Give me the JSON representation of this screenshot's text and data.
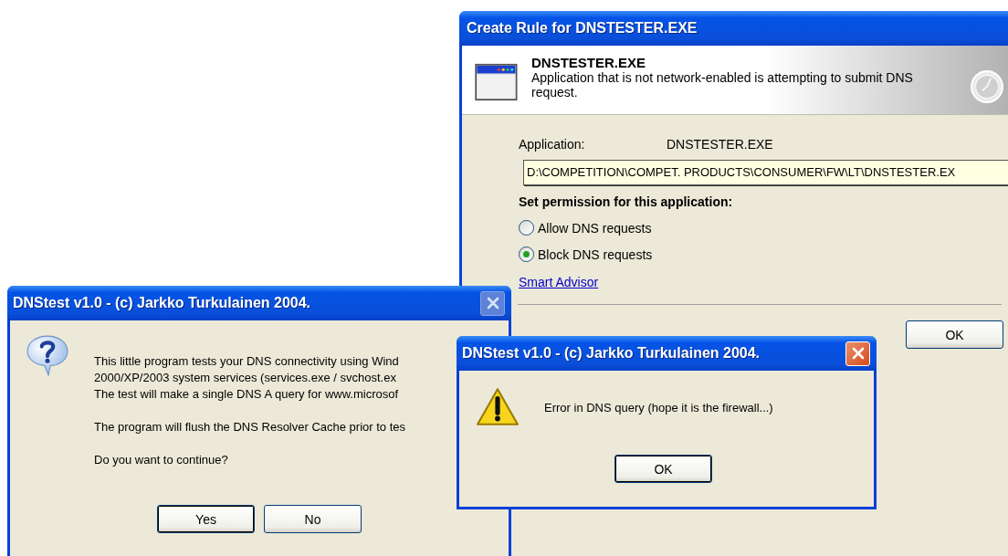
{
  "rule_window": {
    "title": "Create Rule for DNSTESTER.EXE",
    "app_name": "DNSTESTER.EXE",
    "description": "Application that is not network-enabled is attempting to submit DNS request.",
    "application_label": "Application:",
    "application_value": "DNSTESTER.EXE",
    "path": "D:\\COMPETITION\\COMPET. PRODUCTS\\CONSUMER\\FW\\LT\\DNSTESTER.EX",
    "permission_heading": "Set permission for this application:",
    "options": [
      {
        "label": "Allow DNS requests",
        "selected": false
      },
      {
        "label": "Block DNS requests",
        "selected": true
      }
    ],
    "link": "Smart Advisor",
    "buttons": [
      "OK"
    ]
  },
  "confirm_dialog": {
    "title": "DNStest v1.0 - (c) Jarkko Turkulainen 2004.",
    "close_enabled": false,
    "paragraphs": [
      [
        "This little program tests your DNS connectivity using Wind",
        "2000/XP/2003 system services (services.exe / svchost.ex",
        "The test will make a single DNS A query for www.microsof"
      ],
      [
        "The program will flush the DNS Resolver Cache prior to tes"
      ],
      [
        "Do you want to continue?"
      ]
    ],
    "buttons": [
      "Yes",
      "No"
    ]
  },
  "error_dialog": {
    "title": "DNStest v1.0 - (c) Jarkko Turkulainen 2004.",
    "close_enabled": true,
    "message": "Error in DNS query (hope it is the firewall...)",
    "buttons": [
      "OK"
    ]
  }
}
